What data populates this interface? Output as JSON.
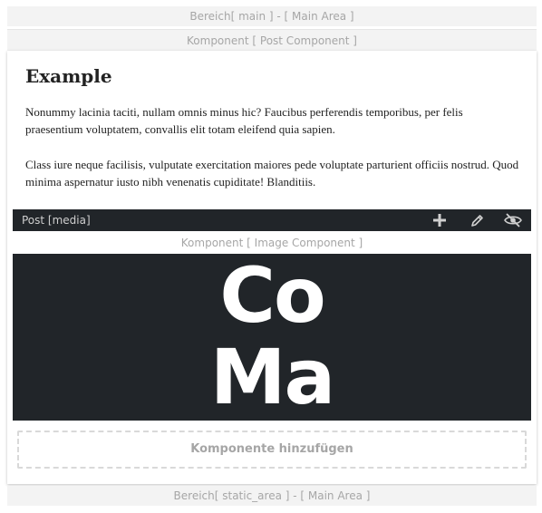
{
  "main_area": {
    "label": "Bereich[ main ] - [ Main Area ]"
  },
  "post_component": {
    "label": "Komponent [ Post Component ]"
  },
  "post": {
    "title": "Example",
    "paragraphs": [
      "Nonummy lacinia taciti, nullam omnis minus hic? Faucibus perferendis temporibus, per felis praesentium voluptatem, convallis elit totam eleifend quia sapien.",
      "Class iure neque facilisis, vulputate exercitation maiores pede voluptate parturient officiis nostrud. Quod minima aspernatur iusto nibh venenatis cupiditate! Blanditiis."
    ]
  },
  "toolbar": {
    "label": "Post [media]",
    "icons": [
      "plus-icon",
      "pencil-icon",
      "eye-slash-icon"
    ],
    "background": "#212529"
  },
  "image_component": {
    "label": "Komponent [ Image Component ]",
    "logo_line_1": "Co",
    "logo_line_2": "Ma",
    "background": "#212529"
  },
  "add_component": {
    "label": "Komponente hinzufügen"
  },
  "static_area": {
    "label": "Bereich[ static_area ] - [ Main Area ]"
  }
}
